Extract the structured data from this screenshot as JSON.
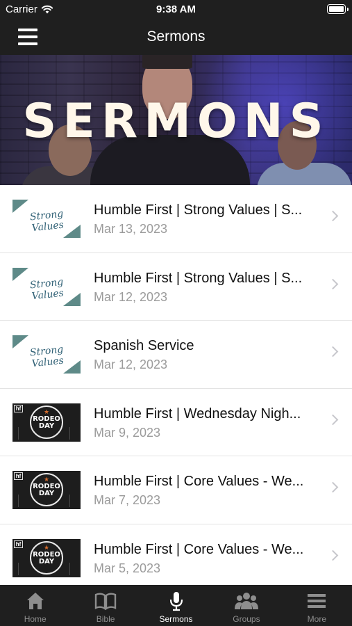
{
  "status_bar": {
    "carrier": "Carrier",
    "time": "9:38 AM"
  },
  "nav": {
    "title": "Sermons"
  },
  "hero": {
    "title": "SERMONS"
  },
  "sermons": [
    {
      "title": "Humble First | Strong Values  | S...",
      "date": "Mar 13, 2023",
      "thumb": "strong-values",
      "thumb_text": "Strong Values"
    },
    {
      "title": "Humble First | Strong Values  | S...",
      "date": "Mar 12, 2023",
      "thumb": "strong-values",
      "thumb_text": "Strong Values"
    },
    {
      "title": "Spanish Service",
      "date": "Mar 12, 2023",
      "thumb": "strong-values",
      "thumb_text": "Strong Values"
    },
    {
      "title": "Humble First | Wednesday Nigh...",
      "date": "Mar 9, 2023",
      "thumb": "rodeo-day",
      "thumb_text": "RODEO DAY",
      "thumb_mark": "hf"
    },
    {
      "title": "Humble First | Core Values - We...",
      "date": "Mar 7, 2023",
      "thumb": "rodeo-day",
      "thumb_text": "RODEO DAY",
      "thumb_mark": "hf"
    },
    {
      "title": "Humble First | Core Values - We...",
      "date": "Mar 5, 2023",
      "thumb": "rodeo-day",
      "thumb_text": "RODEO DAY",
      "thumb_mark": "hf"
    }
  ],
  "tabs": [
    {
      "label": "Home",
      "icon": "home-icon",
      "active": false
    },
    {
      "label": "Bible",
      "icon": "book-icon",
      "active": false
    },
    {
      "label": "Sermons",
      "icon": "microphone-icon",
      "active": true
    },
    {
      "label": "Groups",
      "icon": "people-icon",
      "active": false
    },
    {
      "label": "More",
      "icon": "menu-icon",
      "active": false
    }
  ],
  "colors": {
    "bar_background": "#1f1f1f",
    "accent_teal": "#5e8a88",
    "date_gray": "#9b9b9b",
    "inactive_tab": "#8e8e8e"
  }
}
